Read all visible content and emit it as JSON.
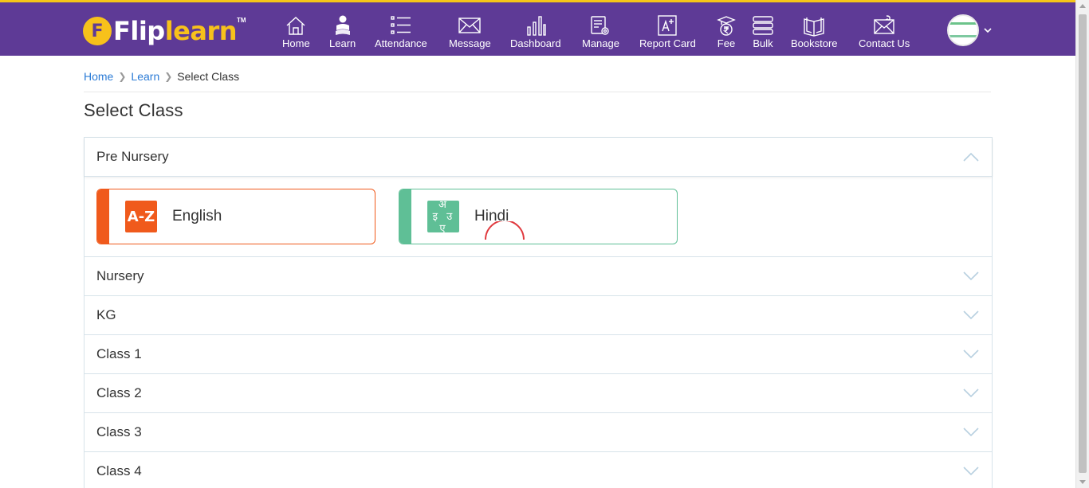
{
  "brand": {
    "name_part1": "Flip",
    "name_part2": "learn",
    "tm": "TM",
    "badge": "F"
  },
  "nav": [
    {
      "id": "home",
      "label": "Home",
      "icon": "home-icon"
    },
    {
      "id": "learn",
      "label": "Learn",
      "icon": "learn-icon"
    },
    {
      "id": "attendance",
      "label": "Attendance",
      "icon": "attendance-icon"
    },
    {
      "id": "message",
      "label": "Message",
      "icon": "envelope-icon"
    },
    {
      "id": "dashboard",
      "label": "Dashboard",
      "icon": "bar-chart-icon"
    },
    {
      "id": "manage",
      "label": "Manage",
      "icon": "manage-icon"
    },
    {
      "id": "report-card",
      "label": "Report Card",
      "icon": "report-card-icon"
    },
    {
      "id": "fee",
      "label": "Fee",
      "icon": "fee-icon"
    },
    {
      "id": "bulk",
      "label": "Bulk",
      "icon": "bulk-icon"
    },
    {
      "id": "bookstore",
      "label": "Bookstore",
      "icon": "book-icon"
    },
    {
      "id": "contact-us",
      "label": "Contact Us",
      "icon": "contact-icon"
    }
  ],
  "breadcrumb": {
    "home": "Home",
    "learn": "Learn",
    "current": "Select Class"
  },
  "page_title": "Select Class",
  "classes": [
    {
      "name": "Pre Nursery",
      "open": true
    },
    {
      "name": "Nursery",
      "open": false
    },
    {
      "name": "KG",
      "open": false
    },
    {
      "name": "Class 1",
      "open": false
    },
    {
      "name": "Class 2",
      "open": false
    },
    {
      "name": "Class 3",
      "open": false
    },
    {
      "name": "Class 4",
      "open": false
    }
  ],
  "subjects": [
    {
      "name": "English",
      "icon_text": "A-Z",
      "color": "#f05a1c"
    },
    {
      "name": "Hindi",
      "icon_text": "अ इ उ ए",
      "color": "#5fbf96"
    }
  ],
  "colors": {
    "brand_purple": "#5e3a96",
    "brand_yellow": "#f7c11b",
    "link_blue": "#2b7bd6",
    "spinner_red": "#e0393e"
  }
}
